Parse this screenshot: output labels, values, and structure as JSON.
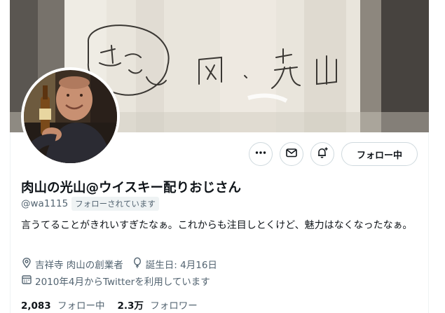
{
  "profile": {
    "display_name": "肉山の光山@ウイスキー配りおじさん",
    "handle": "@wa1115",
    "follows_you": "フォローされています",
    "bio": "言うてることがきれいすぎたなぁ。これからも注目しとくけど、魅力はなくなったなぁ。",
    "location": "吉祥寺 肉山の創業者",
    "birthday": "誕生日: 4月16日",
    "joined": "2010年4月からTwitterを利用しています"
  },
  "actions": {
    "more_icon": "more-horizontal-icon",
    "message_icon": "mail-icon",
    "notify_icon": "bell-plus-icon",
    "follow_label": "フォロー中"
  },
  "stats": {
    "following_count": "2,083",
    "following_label": "フォロー中",
    "followers_count": "2.3万",
    "followers_label": "フォロワー"
  },
  "colors": {
    "text_primary": "#0f1419",
    "text_secondary": "#536471",
    "border": "#cfd9de",
    "badge_bg": "#eff3f4"
  }
}
